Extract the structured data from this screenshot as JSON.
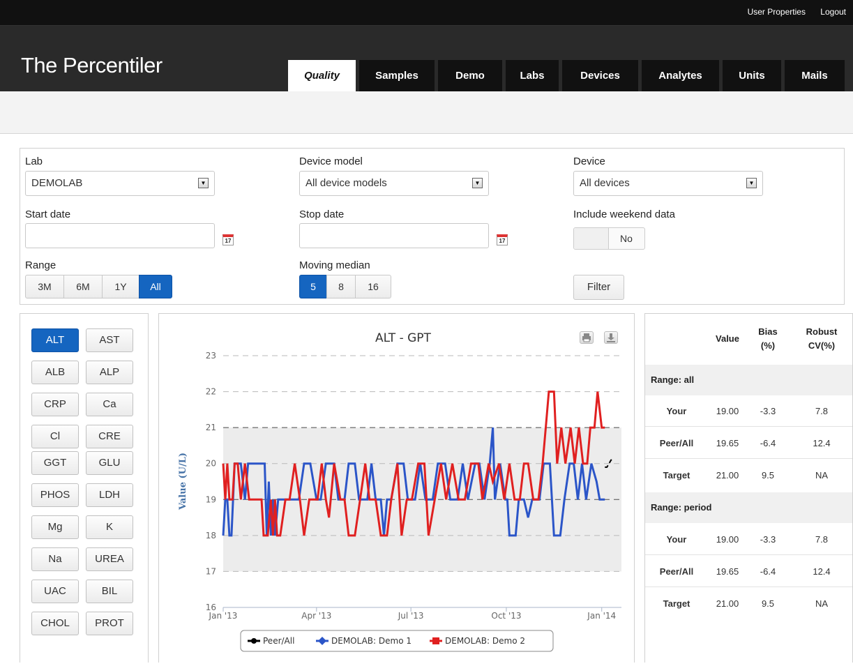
{
  "top_links": {
    "user_properties": "User Properties",
    "logout": "Logout"
  },
  "app": {
    "title": "The Percentiler"
  },
  "tabs": [
    "Quality",
    "Samples",
    "Demo",
    "Labs",
    "Devices",
    "Analytes",
    "Units",
    "Mails"
  ],
  "active_tab": "Quality",
  "filters": {
    "lab": {
      "label": "Lab",
      "value": "DEMOLAB"
    },
    "device_model": {
      "label": "Device model",
      "value": "All device models"
    },
    "device": {
      "label": "Device",
      "value": "All devices"
    },
    "start_date": {
      "label": "Start date",
      "value": ""
    },
    "stop_date": {
      "label": "Stop date",
      "value": ""
    },
    "calendar_icon_text": "17",
    "weekend": {
      "label": "Include weekend data",
      "value": "No"
    },
    "range": {
      "label": "Range",
      "options": [
        "3M",
        "6M",
        "1Y",
        "All"
      ],
      "selected": "All"
    },
    "moving_median": {
      "label": "Moving median",
      "options": [
        "5",
        "8",
        "16"
      ],
      "selected": "5"
    },
    "filter_button": "Filter"
  },
  "analytes": [
    "ALT",
    "AST",
    "ALB",
    "ALP",
    "CRP",
    "Ca",
    "Cl",
    "CRE",
    "GGT",
    "GLU",
    "PHOS",
    "LDH",
    "Mg",
    "K",
    "Na",
    "UREA",
    "UAC",
    "BIL",
    "CHOL",
    "PROT"
  ],
  "selected_analyte": "ALT",
  "chart_data": {
    "type": "line",
    "title": "ALT - GPT",
    "ylabel": "Value (U/L)",
    "xlabel": "",
    "ylim": [
      16,
      23
    ],
    "xlim": [
      "2013-01-01",
      "2014-01-20"
    ],
    "yticks": [
      16,
      17,
      18,
      19,
      20,
      21,
      22,
      23
    ],
    "xticks": [
      "Jan '13",
      "Apr '13",
      "Jul '13",
      "Oct '13",
      "Jan '14"
    ],
    "xtick_dates": [
      "2013-01-01",
      "2013-04-01",
      "2013-07-01",
      "2013-10-01",
      "2014-01-01"
    ],
    "target_band": [
      17,
      21
    ],
    "reference_lines": [
      {
        "value": 21,
        "style": "dark-dashed"
      },
      {
        "value": 19,
        "style": "dark-dashed"
      }
    ],
    "grid": true,
    "legend_position": "bottom",
    "series": [
      {
        "name": "Peer/All",
        "color": "#000000",
        "points": [
          [
            "2014-01-04",
            19.9
          ],
          [
            "2014-01-06",
            19.9
          ],
          [
            "2014-01-08",
            20.0
          ],
          [
            "2014-01-10",
            20.1
          ],
          [
            "2014-01-12",
            20.1
          ]
        ]
      },
      {
        "name": "DEMOLAB: Demo 1",
        "color": "#2b55c8",
        "points": [
          [
            "2013-01-01",
            18
          ],
          [
            "2013-01-03",
            19
          ],
          [
            "2013-01-05",
            19
          ],
          [
            "2013-01-07",
            18
          ],
          [
            "2013-01-09",
            18
          ],
          [
            "2013-01-12",
            20
          ],
          [
            "2013-01-18",
            20
          ],
          [
            "2013-01-22",
            19
          ],
          [
            "2013-01-25",
            20
          ],
          [
            "2013-02-05",
            20
          ],
          [
            "2013-02-10",
            20
          ],
          [
            "2013-02-12",
            18
          ],
          [
            "2013-02-14",
            19.5
          ],
          [
            "2013-02-16",
            18
          ],
          [
            "2013-02-18",
            19
          ],
          [
            "2013-02-20",
            18
          ],
          [
            "2013-02-23",
            19
          ],
          [
            "2013-03-01",
            19
          ],
          [
            "2013-03-08",
            19
          ],
          [
            "2013-03-15",
            19
          ],
          [
            "2013-03-20",
            20
          ],
          [
            "2013-03-26",
            20
          ],
          [
            "2013-04-01",
            19
          ],
          [
            "2013-04-05",
            19
          ],
          [
            "2013-04-10",
            20
          ],
          [
            "2013-04-18",
            20
          ],
          [
            "2013-04-22",
            19
          ],
          [
            "2013-04-28",
            19
          ],
          [
            "2013-05-02",
            20
          ],
          [
            "2013-05-08",
            20
          ],
          [
            "2013-05-12",
            19
          ],
          [
            "2013-05-20",
            19
          ],
          [
            "2013-05-24",
            20
          ],
          [
            "2013-05-28",
            19
          ],
          [
            "2013-06-02",
            19
          ],
          [
            "2013-06-05",
            18
          ],
          [
            "2013-06-08",
            19
          ],
          [
            "2013-06-12",
            19
          ],
          [
            "2013-06-18",
            20
          ],
          [
            "2013-06-24",
            20
          ],
          [
            "2013-06-28",
            19
          ],
          [
            "2013-07-05",
            19
          ],
          [
            "2013-07-10",
            20
          ],
          [
            "2013-07-15",
            19
          ],
          [
            "2013-07-22",
            19
          ],
          [
            "2013-07-27",
            20
          ],
          [
            "2013-08-03",
            20
          ],
          [
            "2013-08-08",
            19
          ],
          [
            "2013-08-15",
            19
          ],
          [
            "2013-08-20",
            20
          ],
          [
            "2013-08-25",
            19
          ],
          [
            "2013-09-01",
            20
          ],
          [
            "2013-09-05",
            20
          ],
          [
            "2013-09-10",
            19
          ],
          [
            "2013-09-15",
            20
          ],
          [
            "2013-09-18",
            21
          ],
          [
            "2013-09-20",
            19
          ],
          [
            "2013-09-25",
            20
          ],
          [
            "2013-09-30",
            19
          ],
          [
            "2013-10-02",
            19
          ],
          [
            "2013-10-04",
            18
          ],
          [
            "2013-10-10",
            18
          ],
          [
            "2013-10-13",
            19
          ],
          [
            "2013-10-18",
            19
          ],
          [
            "2013-10-22",
            18.5
          ],
          [
            "2013-10-26",
            19
          ],
          [
            "2013-11-02",
            19
          ],
          [
            "2013-11-06",
            20
          ],
          [
            "2013-11-12",
            20
          ],
          [
            "2013-11-16",
            18
          ],
          [
            "2013-11-22",
            18
          ],
          [
            "2013-11-26",
            19
          ],
          [
            "2013-12-01",
            20
          ],
          [
            "2013-12-05",
            20
          ],
          [
            "2013-12-09",
            19
          ],
          [
            "2013-12-13",
            20
          ],
          [
            "2013-12-17",
            19
          ],
          [
            "2013-12-22",
            20
          ],
          [
            "2013-12-27",
            19.5
          ],
          [
            "2013-12-30",
            19
          ],
          [
            "2014-01-04",
            19
          ]
        ]
      },
      {
        "name": "DEMOLAB: Demo 2",
        "color": "#e02020",
        "points": [
          [
            "2013-01-01",
            20
          ],
          [
            "2013-01-03",
            19
          ],
          [
            "2013-01-05",
            20
          ],
          [
            "2013-01-07",
            19
          ],
          [
            "2013-01-10",
            19
          ],
          [
            "2013-01-12",
            20
          ],
          [
            "2013-01-15",
            20
          ],
          [
            "2013-01-18",
            19
          ],
          [
            "2013-01-22",
            20
          ],
          [
            "2013-01-26",
            19
          ],
          [
            "2013-02-02",
            19
          ],
          [
            "2013-02-07",
            19
          ],
          [
            "2013-02-09",
            18
          ],
          [
            "2013-02-13",
            18
          ],
          [
            "2013-02-16",
            19
          ],
          [
            "2013-02-18",
            18
          ],
          [
            "2013-02-20",
            19
          ],
          [
            "2013-02-22",
            18
          ],
          [
            "2013-02-25",
            18
          ],
          [
            "2013-03-02",
            19
          ],
          [
            "2013-03-06",
            19
          ],
          [
            "2013-03-11",
            20
          ],
          [
            "2013-03-16",
            19
          ],
          [
            "2013-03-20",
            18
          ],
          [
            "2013-03-25",
            19
          ],
          [
            "2013-04-02",
            19
          ],
          [
            "2013-04-06",
            20
          ],
          [
            "2013-04-10",
            19
          ],
          [
            "2013-04-13",
            18.5
          ],
          [
            "2013-04-18",
            20
          ],
          [
            "2013-04-24",
            19
          ],
          [
            "2013-04-28",
            19
          ],
          [
            "2013-05-02",
            18
          ],
          [
            "2013-05-08",
            18
          ],
          [
            "2013-05-13",
            19
          ],
          [
            "2013-05-18",
            20
          ],
          [
            "2013-05-22",
            19
          ],
          [
            "2013-05-28",
            19
          ],
          [
            "2013-06-02",
            18
          ],
          [
            "2013-06-08",
            18
          ],
          [
            "2013-06-12",
            19
          ],
          [
            "2013-06-18",
            20
          ],
          [
            "2013-06-22",
            18
          ],
          [
            "2013-06-27",
            19
          ],
          [
            "2013-07-02",
            19
          ],
          [
            "2013-07-08",
            20
          ],
          [
            "2013-07-14",
            20
          ],
          [
            "2013-07-18",
            18
          ],
          [
            "2013-07-24",
            19
          ],
          [
            "2013-07-30",
            20
          ],
          [
            "2013-08-04",
            19
          ],
          [
            "2013-08-10",
            20
          ],
          [
            "2013-08-16",
            19
          ],
          [
            "2013-08-22",
            19
          ],
          [
            "2013-08-28",
            20
          ],
          [
            "2013-09-04",
            20
          ],
          [
            "2013-09-08",
            19
          ],
          [
            "2013-09-14",
            20
          ],
          [
            "2013-09-18",
            19.5
          ],
          [
            "2013-09-24",
            20
          ],
          [
            "2013-09-29",
            19
          ],
          [
            "2013-10-04",
            20
          ],
          [
            "2013-10-09",
            19
          ],
          [
            "2013-10-14",
            19
          ],
          [
            "2013-10-18",
            20
          ],
          [
            "2013-10-22",
            20
          ],
          [
            "2013-10-27",
            19
          ],
          [
            "2013-11-01",
            19
          ],
          [
            "2013-11-05",
            20
          ],
          [
            "2013-11-08",
            21
          ],
          [
            "2013-11-11",
            22
          ],
          [
            "2013-11-16",
            22
          ],
          [
            "2013-11-19",
            20
          ],
          [
            "2013-11-23",
            21
          ],
          [
            "2013-11-27",
            20
          ],
          [
            "2013-12-02",
            21
          ],
          [
            "2013-12-06",
            20
          ],
          [
            "2013-12-10",
            21
          ],
          [
            "2013-12-14",
            20
          ],
          [
            "2013-12-18",
            20
          ],
          [
            "2013-12-21",
            21
          ],
          [
            "2013-12-25",
            21
          ],
          [
            "2013-12-28",
            22
          ],
          [
            "2014-01-01",
            21
          ],
          [
            "2014-01-04",
            21
          ]
        ]
      }
    ]
  },
  "stats": {
    "headers": {
      "value": "Value",
      "bias": "Bias",
      "bias_unit": "(%)",
      "cv": "Robust",
      "cv_unit": "CV(%)"
    },
    "sections": [
      {
        "label": "Range: all",
        "rows": [
          {
            "name": "Your",
            "value": "19.00",
            "bias": "-3.3",
            "cv": "7.8"
          },
          {
            "name": "Peer/All",
            "value": "19.65",
            "bias": "-6.4",
            "cv": "12.4"
          },
          {
            "name": "Target",
            "value": "21.00",
            "bias": "9.5",
            "cv": "NA"
          }
        ]
      },
      {
        "label": "Range: period",
        "rows": [
          {
            "name": "Your",
            "value": "19.00",
            "bias": "-3.3",
            "cv": "7.8"
          },
          {
            "name": "Peer/All",
            "value": "19.65",
            "bias": "-6.4",
            "cv": "12.4"
          },
          {
            "name": "Target",
            "value": "21.00",
            "bias": "9.5",
            "cv": "NA"
          }
        ]
      }
    ]
  },
  "icons": {
    "print": "print-icon",
    "download": "download-icon",
    "select_arrow": "chevron-down-icon",
    "calendar": "calendar-icon"
  }
}
